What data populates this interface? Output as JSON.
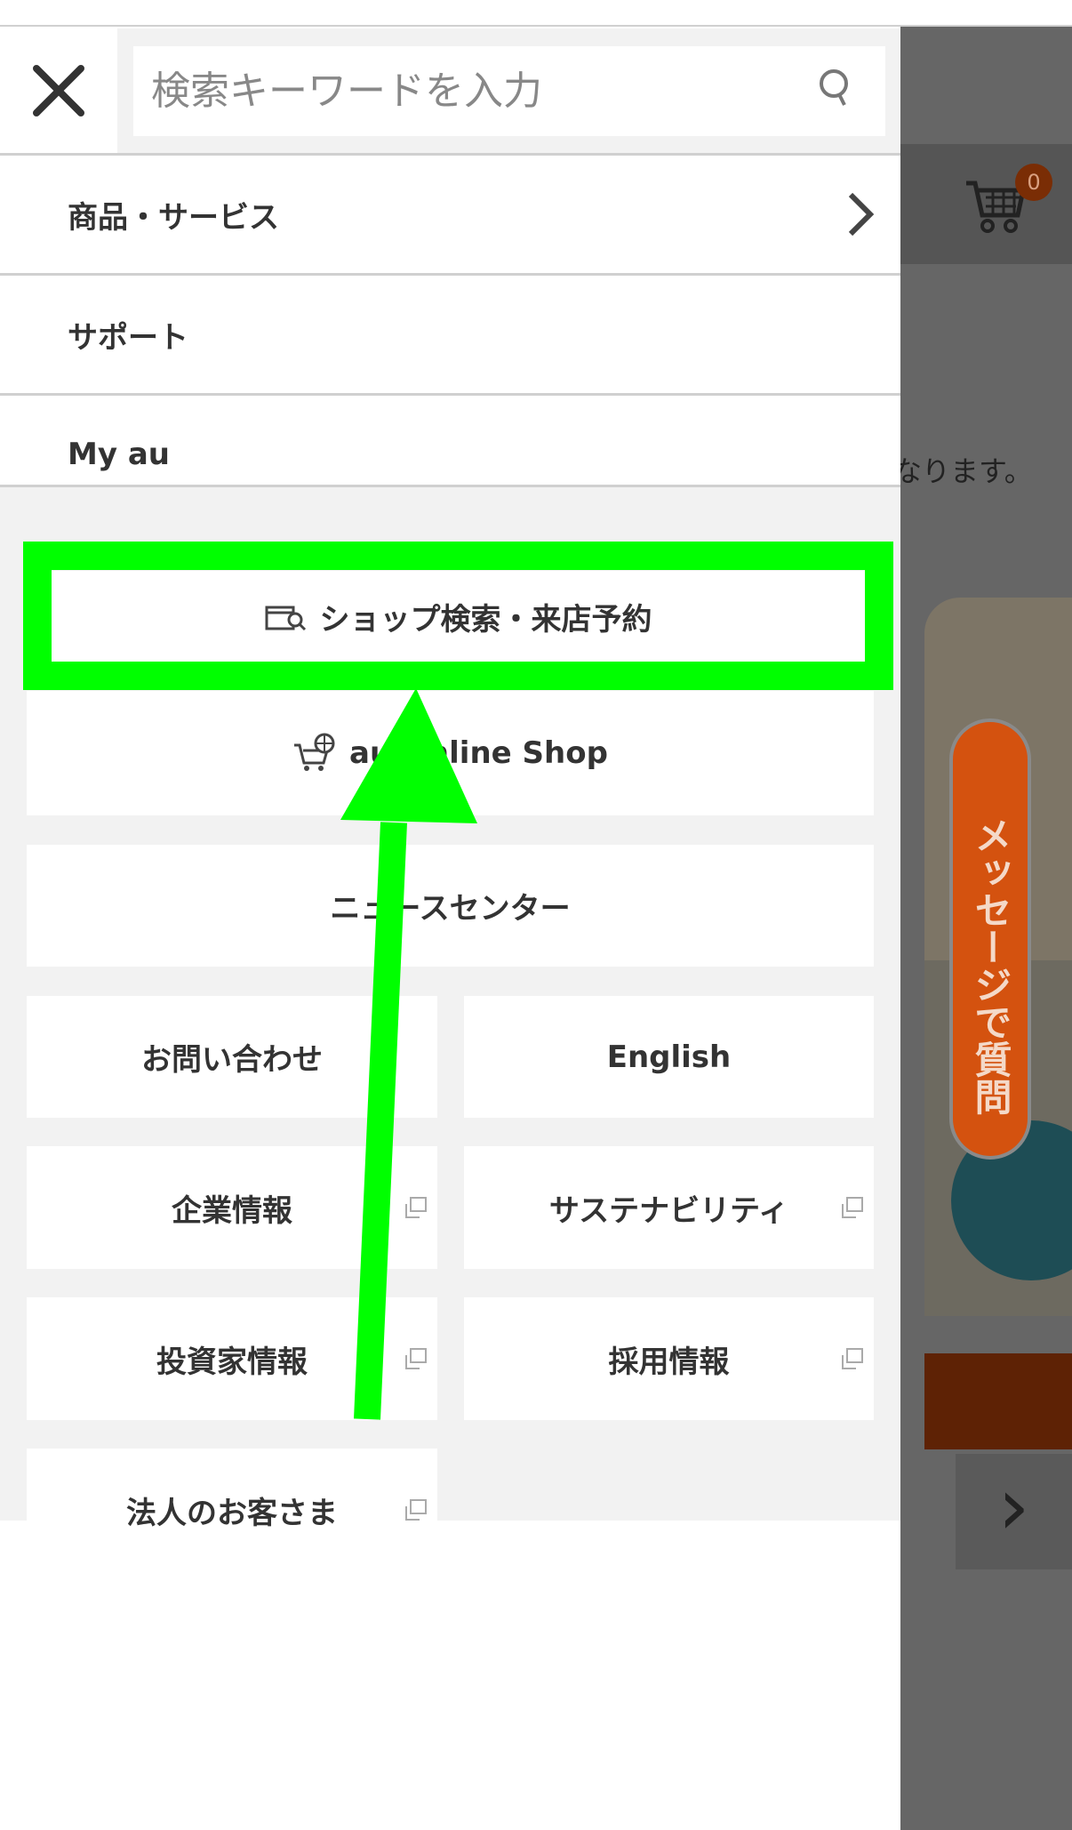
{
  "search": {
    "placeholder": "検索キーワードを入力"
  },
  "nav": [
    {
      "label": "商品・サービス",
      "has_chevron": true
    },
    {
      "label": "サポート"
    },
    {
      "label": "My au"
    }
  ],
  "buttons": {
    "shop_search": "ショップ検索・来店予約",
    "online_shop": "au Online Shop",
    "news_center": "ニュースセンター",
    "contact": "お問い合わせ",
    "english": "English",
    "corporate": "企業情報",
    "sustainability": "サステナビリティ",
    "investor": "投資家情報",
    "recruit": "採用情報",
    "business": "法人のお客さま"
  },
  "background": {
    "cart_count": "0",
    "partial_text": "なります。",
    "chat_tab": "メッセージで質問"
  },
  "colors": {
    "highlight": "#00ff00",
    "overlay": "#666666",
    "chat_tab": "#d4520f"
  }
}
